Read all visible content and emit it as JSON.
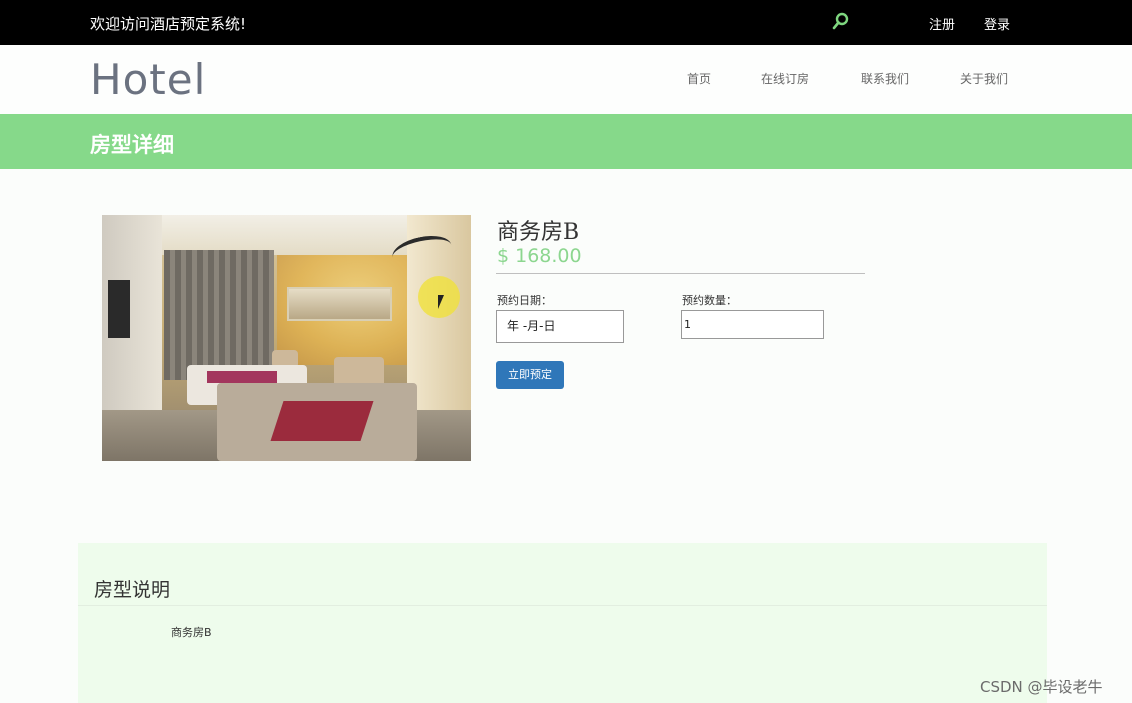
{
  "topbar": {
    "welcome": "欢迎访问酒店预定系统!",
    "search_icon": "search-icon",
    "register": "注册",
    "login": "登录"
  },
  "header": {
    "logo": "Hotel",
    "nav": [
      "首页",
      "在线订房",
      "联系我们",
      "关于我们"
    ]
  },
  "banner": {
    "title": "房型详细"
  },
  "room": {
    "name": "商务房B",
    "price": "$ 168.00",
    "date_label": "预约日期：",
    "date_value": "年 -月-日",
    "qty_label": "预约数量：",
    "qty_value": "1",
    "book_button": "立即预定"
  },
  "description": {
    "title": "房型说明",
    "text": "商务房B"
  },
  "watermark": "CSDN @毕设老牛",
  "colors": {
    "banner": "#86d98a",
    "price": "#8cd68f",
    "button": "#2f77b9",
    "panel": "#eefcec"
  }
}
